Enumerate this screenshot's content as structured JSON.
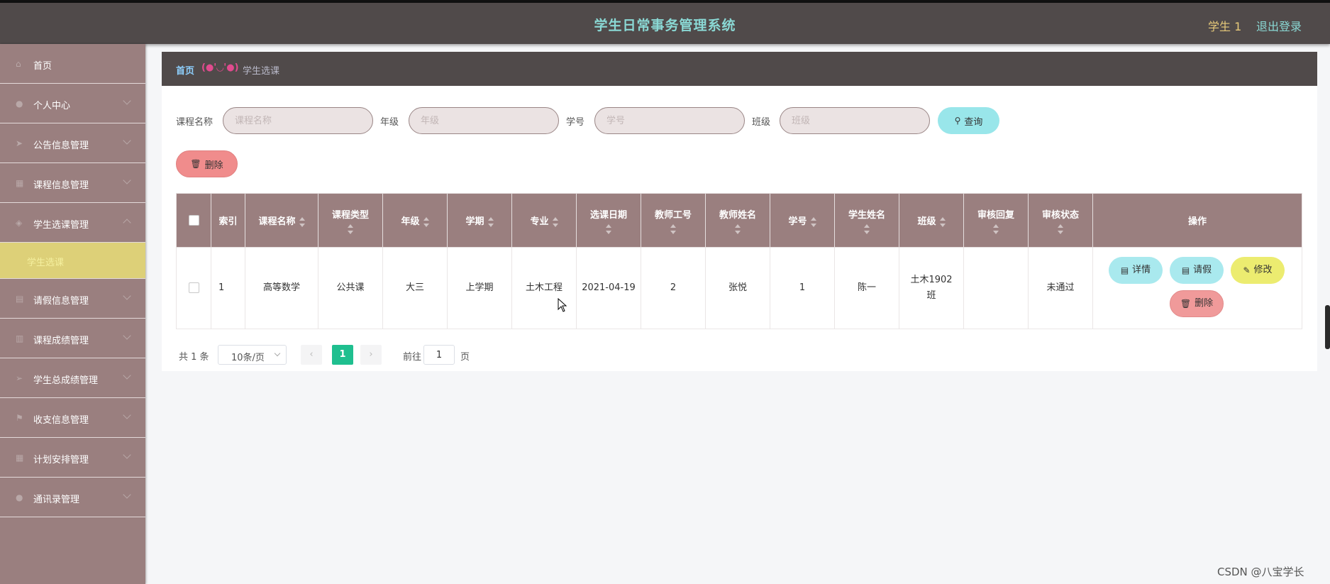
{
  "header": {
    "title": "学生日常事务管理系统",
    "user": "学生 1",
    "logout": "退出登录"
  },
  "sidebar": {
    "items": [
      {
        "label": "首页",
        "icon": "home-icon",
        "glyph": "⌂"
      },
      {
        "label": "个人中心",
        "icon": "user-icon",
        "glyph": "●"
      },
      {
        "label": "公告信息管理",
        "icon": "send-icon",
        "glyph": "➤"
      },
      {
        "label": "课程信息管理",
        "icon": "grid-icon",
        "glyph": "▦"
      },
      {
        "label": "学生选课管理",
        "icon": "tag-icon",
        "glyph": "◈"
      },
      {
        "label": "请假信息管理",
        "icon": "list-icon",
        "glyph": "▤"
      },
      {
        "label": "课程成绩管理",
        "icon": "bar-chart-icon",
        "glyph": "▥"
      },
      {
        "label": "学生总成绩管理",
        "icon": "paper-plane-icon",
        "glyph": "➢"
      },
      {
        "label": "收支信息管理",
        "icon": "flag-icon",
        "glyph": "⚑"
      },
      {
        "label": "计划安排管理",
        "icon": "table-icon",
        "glyph": "▦"
      },
      {
        "label": "通讯录管理",
        "icon": "contact-icon",
        "glyph": "●"
      }
    ],
    "active_sub": "学生选课"
  },
  "breadcrumb": {
    "home": "首页",
    "sep": "(●'◡'●)",
    "current": "学生选课"
  },
  "filters": {
    "course_label": "课程名称",
    "course_placeholder": "课程名称",
    "grade_label": "年级",
    "grade_placeholder": "年级",
    "student_id_label": "学号",
    "student_id_placeholder": "学号",
    "class_label": "班级",
    "class_placeholder": "班级",
    "query": "查询"
  },
  "toolbar": {
    "delete": "删除"
  },
  "table": {
    "headers": [
      "索引",
      "课程名称",
      "课程类型",
      "年级",
      "学期",
      "专业",
      "选课日期",
      "教师工号",
      "教师姓名",
      "学号",
      "学生姓名",
      "班级",
      "审核回复",
      "审核状态",
      "操作"
    ],
    "rows": [
      {
        "index": "1",
        "course": "高等数学",
        "type": "公共课",
        "grade": "大三",
        "term": "上学期",
        "major": "土木工程",
        "date": "2021-04-19",
        "teacher_id": "2",
        "teacher_name": "张悦",
        "student_id": "1",
        "student_name": "陈一",
        "class": "土木1902班",
        "reply": "",
        "status": "未通过"
      }
    ],
    "actions": {
      "detail": "详情",
      "leave": "请假",
      "edit": "修改",
      "delete": "删除"
    }
  },
  "pagination": {
    "total": "共 1 条",
    "page_size": "10条/页",
    "current": "1",
    "goto": "前往",
    "goto_value": "1",
    "page_suffix": "页"
  },
  "watermark": "CSDN @八宝学长",
  "colors": {
    "header": "#504a4a",
    "sidebar": "#9a7f7f",
    "title": "#8ad8d4",
    "active_sub": "#ddd078",
    "pager_active": "#1fbf8f"
  }
}
